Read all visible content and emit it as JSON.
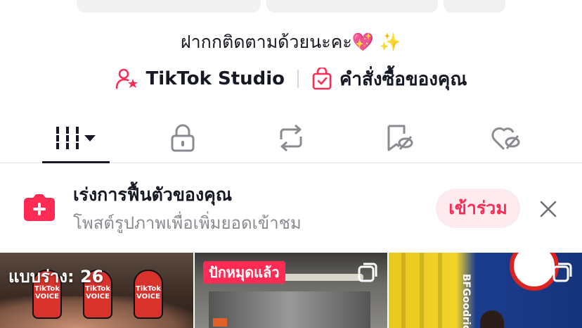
{
  "profile": {
    "bio": "ฝากกติดตามด้วยนะคะ💖 ✨"
  },
  "links": {
    "studio_label": "TikTok Studio",
    "orders_label": "คำสั่งซื้อของคุณ"
  },
  "tabs": [
    {
      "name": "videos",
      "icon": "grid-bars-icon",
      "active": true
    },
    {
      "name": "private",
      "icon": "lock-icon"
    },
    {
      "name": "reposts",
      "icon": "repost-icon"
    },
    {
      "name": "favorites",
      "icon": "bookmark-hidden-icon"
    },
    {
      "name": "liked",
      "icon": "heart-hidden-icon"
    }
  ],
  "banner": {
    "title": "เร่งการฟื้นตัวของคุณ",
    "subtitle": "โพสต์รูปภาพเพื่อเพิ่มยอดเข้าชม",
    "join_label": "เข้าร่วม"
  },
  "grid": {
    "items": [
      {
        "label": "แบบร่าง: 26",
        "mic_text": "TikTok\nVOICE"
      },
      {
        "badge": "ปักหมุดแล้ว"
      },
      {
        "brand": "BFGoodrich"
      }
    ]
  },
  "colors": {
    "accent": "#fe2c55",
    "accent_light": "#fdeaee",
    "text": "#161823",
    "secondary_text": "#8a8b91"
  }
}
